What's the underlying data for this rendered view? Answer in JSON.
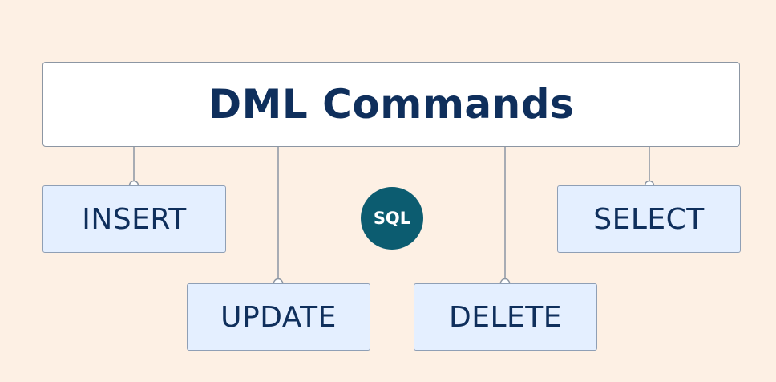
{
  "diagram": {
    "title": "DML Commands",
    "badge": "SQL",
    "commands": [
      {
        "id": "insert",
        "label": "INSERT"
      },
      {
        "id": "update",
        "label": "UPDATE"
      },
      {
        "id": "delete",
        "label": "DELETE"
      },
      {
        "id": "select",
        "label": "SELECT"
      }
    ]
  },
  "colors": {
    "background": "#fdf0e4",
    "title_text": "#0f2f5c",
    "command_fill": "#e4efff",
    "border": "#8c96a3",
    "badge_fill": "#0c5c70",
    "badge_text": "#ffffff"
  }
}
